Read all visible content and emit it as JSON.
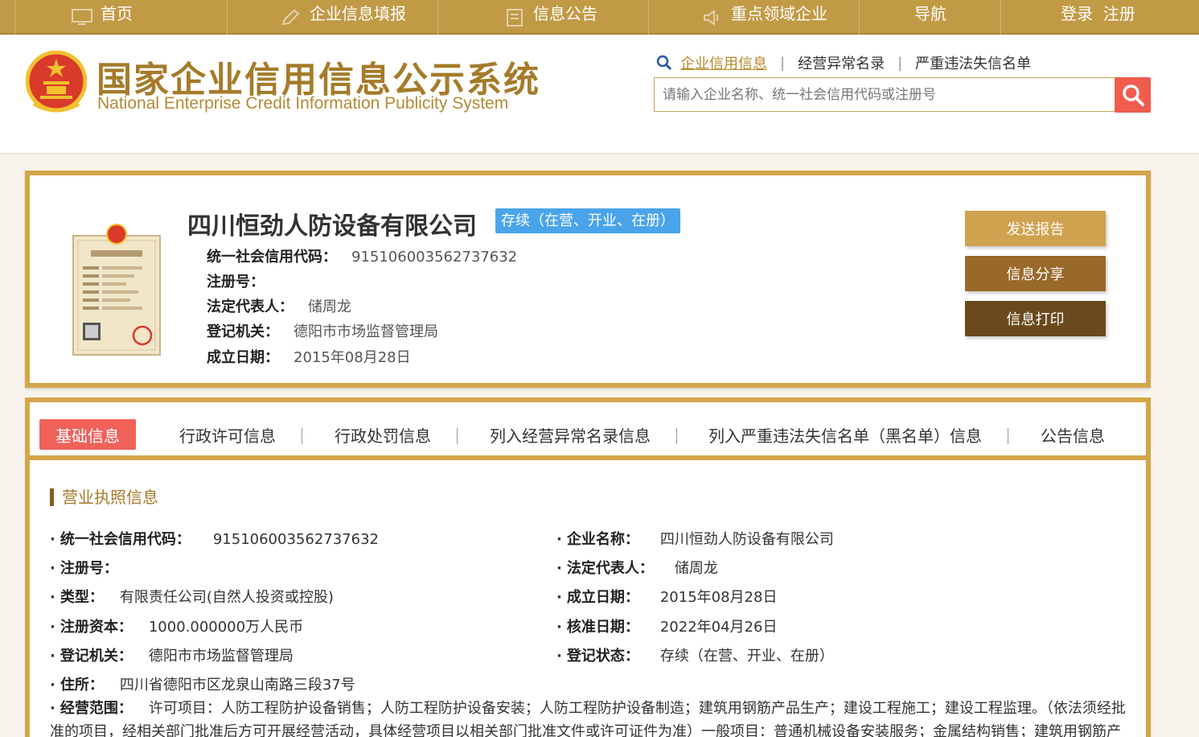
{
  "nav": {
    "items": [
      {
        "label": "首页",
        "icon": "monitor-icon"
      },
      {
        "label": "企业信息填报",
        "icon": "edit-icon"
      },
      {
        "label": "信息公告",
        "icon": "document-icon"
      },
      {
        "label": "重点领域企业",
        "icon": "speaker-icon"
      },
      {
        "label": "导航",
        "icon": ""
      },
      {
        "label": "登录  注册",
        "icon": ""
      }
    ]
  },
  "header": {
    "title_cn": "国家企业信用信息公示系统",
    "title_en": "National Enterprise Credit Information Publicity System",
    "search_tabs": [
      "企业信用信息",
      "经营异常名录",
      "严重违法失信名单"
    ],
    "search_placeholder": "请输入企业名称、统一社会信用代码或注册号"
  },
  "company": {
    "name": "四川恒劲人防设备有限公司",
    "status": "存续（在营、开业、在册）",
    "fields": [
      {
        "key": "统一社会信用代码：",
        "value": "915106003562737632"
      },
      {
        "key": "注册号：",
        "value": ""
      },
      {
        "key": "法定代表人：",
        "value": "储周龙"
      },
      {
        "key": "登记机关：",
        "value": "德阳市市场监督管理局"
      },
      {
        "key": "成立日期：",
        "value": "2015年08月28日"
      }
    ],
    "buttons": {
      "send": "发送报告",
      "share": "信息分享",
      "print": "信息打印"
    }
  },
  "detail": {
    "tabs": [
      "基础信息",
      "行政许可信息",
      "行政处罚信息",
      "列入经营异常名录信息",
      "列入严重违法失信名单（黑名单）信息",
      "公告信息"
    ],
    "section_title": "营业执照信息",
    "left": [
      {
        "key": "统一社会信用代码：",
        "value": "915106003562737632"
      },
      {
        "key": "注册号：",
        "value": ""
      },
      {
        "key": "类型：",
        "value": "有限责任公司(自然人投资或控股)"
      },
      {
        "key": "注册资本：",
        "value": "1000.000000万人民币"
      },
      {
        "key": "登记机关：",
        "value": "德阳市市场监督管理局"
      },
      {
        "key": "住所：",
        "value": "四川省德阳市区龙泉山南路三段37号"
      }
    ],
    "right": [
      {
        "key": "企业名称：",
        "value": "四川恒劲人防设备有限公司"
      },
      {
        "key": "法定代表人：",
        "value": "储周龙"
      },
      {
        "key": "成立日期：",
        "value": "2015年08月28日"
      },
      {
        "key": "核准日期：",
        "value": "2022年04月26日"
      },
      {
        "key": "登记状态：",
        "value": "存续（在营、开业、在册）"
      }
    ],
    "scope_key": "经营范围：",
    "scope_value": "许可项目：人防工程防护设备销售；人防工程防护设备安装；人防工程防护设备制造；建筑用钢筋产品生产；建设工程施工；建设工程监理。（依法须经批准的项目，经相关部门批准后方可开展经营活动，具体经营项目以相关部门批准文件或许可证件为准）一般项目：普通机械设备安装服务；金属结构销售；建筑用钢筋产品"
  },
  "colors": {
    "gold": "#d4a64a",
    "nav": "#c19a45",
    "accent_red": "#f0615a",
    "badge_blue": "#4aa4ea"
  }
}
